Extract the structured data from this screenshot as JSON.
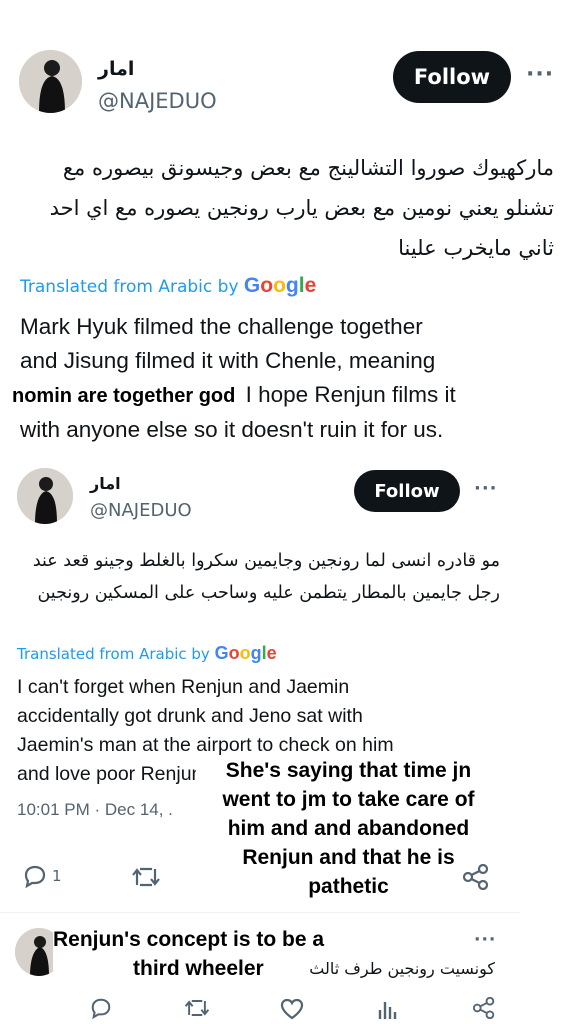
{
  "tweet1": {
    "display_name": "امار",
    "handle": "@NAJEDUO",
    "follow_label": "Follow",
    "more_label": "···",
    "arabic_text": "ماركهيوك صوروا التشالينج مع بعض وجيسونق بيصوره مع تشنلو يعني نومين مع بعض يارب رونجين يصوره مع اي احد ثاني مايخرب علينا",
    "translated_label": "Translated from Arabic by",
    "translation_line1": "Mark Hyuk filmed the challenge together",
    "translation_line2": "and Jisung filmed it with Chenle, meaning",
    "translation_line3_rest": "I hope Renjun films it",
    "translation_line4": "with anyone else so it doesn't ruin it for us."
  },
  "overlay1": {
    "text": "nomin are together god"
  },
  "tweet2": {
    "display_name": "امار",
    "handle": "@NAJEDUO",
    "follow_label": "Follow",
    "more_label": "···",
    "arabic_text": "مو قادره انسى لما رونجين وجايمين سكروا بالغلط وجينو قعد عند رجل جايمين بالمطار يتطمن عليه وساحب على المسكين رونجين",
    "translated_label": "Translated from Arabic by",
    "translation_line1": "I can't forget when Renjun and Jaemin",
    "translation_line2": "accidentally got drunk and Jeno sat with",
    "translation_line3": "Jaemin's man at the airport to check on him",
    "translation_line4": "and love poor Renjun",
    "timestamp": "10:01 PM · Dec 14, .",
    "reply_count": "1"
  },
  "overlay2": {
    "line1": "She's saying that time jn",
    "line2": "went to jm to take care of",
    "line3": "him and and abandoned",
    "line4": "Renjun and that he is",
    "line5": "pathetic"
  },
  "tweet3": {
    "more_label": "···",
    "arabic_text": "كونسيت رونجين طرف ثالث"
  },
  "overlay3": {
    "line1": "Renjun's concept is to be a",
    "line2": "third wheeler"
  },
  "google_logo": {
    "letters": [
      "G",
      "o",
      "o",
      "g",
      "l",
      "e"
    ]
  },
  "icons": [
    "reply-icon",
    "retweet-icon",
    "like-icon",
    "views-icon",
    "share-icon"
  ]
}
